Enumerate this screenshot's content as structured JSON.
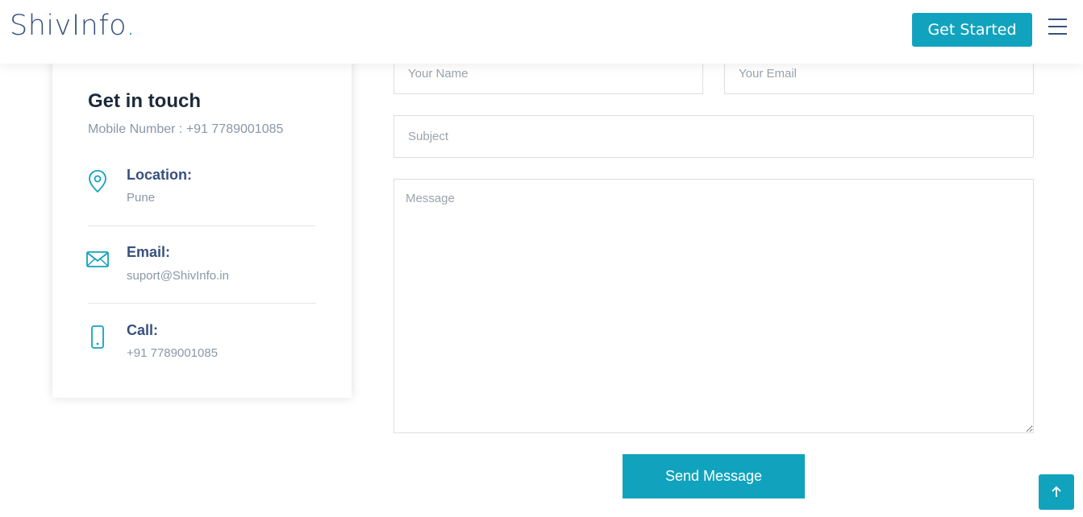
{
  "header": {
    "logo_text": "ShivInfo",
    "logo_dot": ".",
    "cta_label": "Get Started",
    "menu_icon": "hamburger-icon"
  },
  "contact": {
    "title": "Get in touch",
    "mobile_line": "Mobile Number : +91 7789001085",
    "items": [
      {
        "icon": "location-pin-icon",
        "label": "Location:",
        "value": "Pune"
      },
      {
        "icon": "envelope-icon",
        "label": "Email:",
        "value": "suport@ShivInfo.in"
      },
      {
        "icon": "mobile-phone-icon",
        "label": "Call:",
        "value": "+91 7789001085"
      }
    ]
  },
  "form": {
    "name_placeholder": "Your Name",
    "email_placeholder": "Your Email",
    "subject_placeholder": "Subject",
    "message_placeholder": "Message",
    "submit_label": "Send Message"
  },
  "colors": {
    "accent": "#11a3bd",
    "heading": "#37517e",
    "muted": "#8a97a8"
  },
  "back_to_top_icon": "arrow-up-icon"
}
